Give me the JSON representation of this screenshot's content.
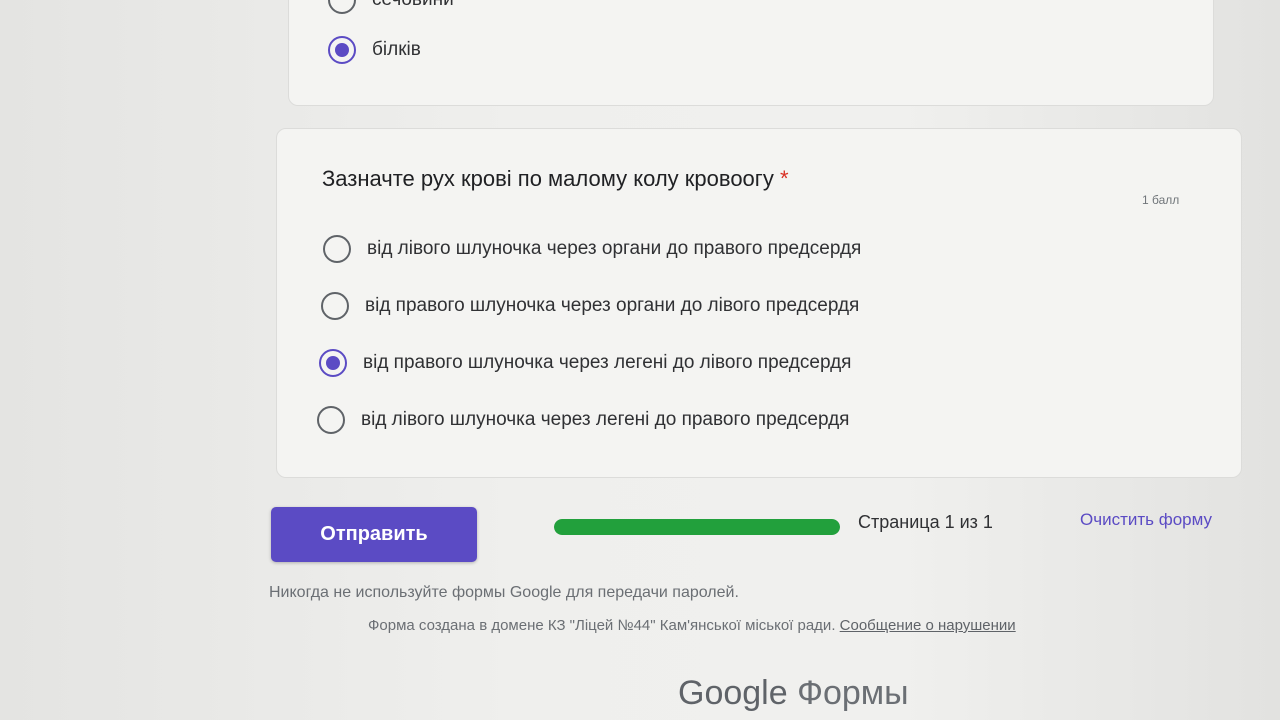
{
  "previous_question": {
    "options": [
      {
        "label": "сечовини",
        "checked": false
      },
      {
        "label": "білків",
        "checked": true
      }
    ]
  },
  "question": {
    "title": "Зазначте рух крові по малому колу кровоогу",
    "required_marker": "*",
    "points": "1 балл",
    "options": [
      {
        "label": "від лівого шлуночка через органи до правого предсердя",
        "checked": false
      },
      {
        "label": "від правого шлуночка через органи до лівого предсердя",
        "checked": false
      },
      {
        "label": "від правого шлуночка через легені до лівого предсердя",
        "checked": true
      },
      {
        "label": "від лівого шлуночка через легені до правого предсердя",
        "checked": false
      }
    ]
  },
  "footer": {
    "submit_label": "Отправить",
    "progress_fraction": 1.0,
    "page_indicator": "Страница 1 из 1",
    "clear_label": "Очистить форму",
    "password_warning": "Никогда не используйте формы Google для передачи паролей.",
    "domain_text": "Форма создана в домене КЗ \"Ліцей №44\" Кам'янської міської ради.",
    "report_label": "Сообщение о нарушении",
    "brand_google": "Google",
    "brand_forms": "Формы"
  },
  "colors": {
    "accent": "#5b4bc4",
    "progress": "#22a03c",
    "required": "#d93025"
  }
}
